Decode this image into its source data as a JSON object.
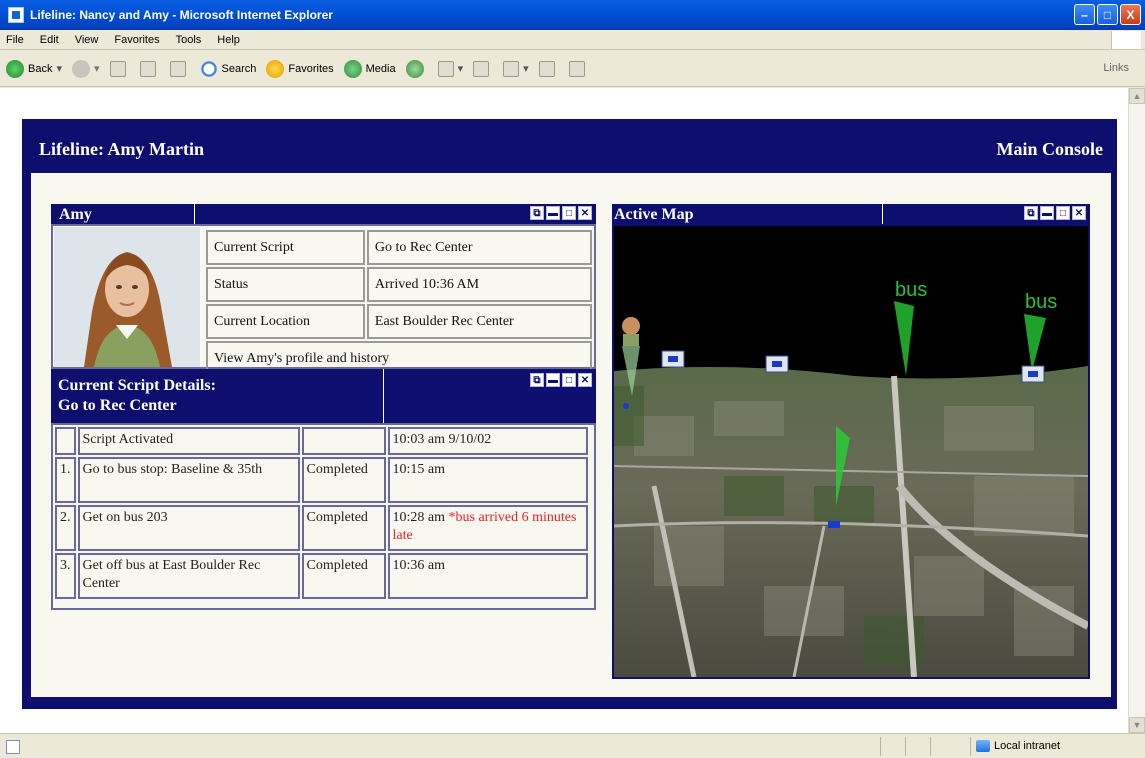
{
  "window": {
    "title": "Lifeline: Nancy and Amy - Microsoft Internet Explorer",
    "minimize": "–",
    "maximize": "□",
    "close": "X"
  },
  "menu": [
    "File",
    "Edit",
    "View",
    "Favorites",
    "Tools",
    "Help"
  ],
  "toolbar": {
    "back": "Back",
    "search": "Search",
    "favorites": "Favorites",
    "media": "Media",
    "links": "Links"
  },
  "page": {
    "title": "Lifeline: Amy Martin",
    "console": "Main Console"
  },
  "person": {
    "name": "Amy",
    "current_script_label": "Current Script",
    "current_script_value": "Go to Rec Center",
    "status_label": "Status",
    "status_value": "Arrived 10:36 AM",
    "location_label": "Current Location",
    "location_value": "East Boulder Rec Center",
    "profile_link": "View Amy's profile and history"
  },
  "script": {
    "heading_line1": "Current Script Details:",
    "heading_line2": "Go to Rec Center",
    "activated_label": "Script Activated",
    "activated_time": "10:03 am 9/10/02",
    "steps": [
      {
        "num": "1.",
        "desc": "Go to bus stop: Baseline & 35th",
        "status": "Completed",
        "time": "10:15 am",
        "note": ""
      },
      {
        "num": "2.",
        "desc": "Get on bus 203",
        "status": "Completed",
        "time": "10:28 am",
        "note": "*bus arrived 6 minutes late"
      },
      {
        "num": "3.",
        "desc": "Get off bus at East Boulder Rec Center",
        "status": "Completed",
        "time": "10:36 am",
        "note": ""
      }
    ]
  },
  "map": {
    "title": "Active Map",
    "label_bus_1": "bus",
    "label_bus_2": "bus"
  },
  "statusbar": {
    "zone": "Local intranet"
  },
  "colors": {
    "page_navy": "#0e0e6e",
    "completed_green": "#1b9a2b",
    "alert_red": "#e8202a",
    "link_blue": "#1a1ad8"
  }
}
